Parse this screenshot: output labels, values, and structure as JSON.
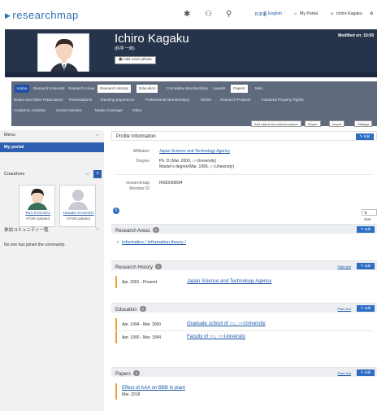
{
  "header": {
    "logo": "researchmap",
    "lang_jp": "日本語",
    "lang_sep": " | ",
    "lang_en": "English",
    "my_portal": "My Portal",
    "user": "Ichiro Kagaku"
  },
  "profile": {
    "name": "Ichiro Kagaku",
    "kana": "(科学 一郎)",
    "cover_button": "Add cover photo",
    "modified": "Modified on: 10:09"
  },
  "nav": {
    "tabs": [
      "Home",
      "Research Interests",
      "Research Areas",
      "Research History",
      "Education",
      "Committee Memberships",
      "Awards",
      "Papers",
      "Misc.",
      "Books and Other Publications",
      "Presentations",
      "Teaching Experience",
      "Professional Memberships",
      "Works",
      "Research Projects",
      "Industrial Property Rights",
      "Academic Activities",
      "Social Activities",
      "Media Coverage",
      "Other"
    ],
    "actions": [
      "Add data from external source",
      "Export",
      "Import",
      "Settings"
    ]
  },
  "sidebar": {
    "menu_title": "Menu",
    "my_portal": "My portal",
    "coauthors_title": "Coauthors",
    "coauthors": [
      {
        "name": "Taro KAGAKU",
        "date": "07/28 Updated"
      },
      {
        "name": "Hanako KAGAKU",
        "date": "07/28 Updated"
      }
    ],
    "community_title": "参加コミュニティ一覧",
    "community_empty": "No one has joined the community."
  },
  "profile_info": {
    "title": "Profile Information",
    "edit": "Edit",
    "affiliation_label": "Affiliation",
    "affiliation": "Japan Science and Technology Agency",
    "degree_label": "Degree",
    "degree_1": "Ph. D.(Mar. 2000, ○○University)",
    "degree_2": "Master's degree(Mar. 1996, ○○University)",
    "member_id_label_1": "researchmap",
    "member_id_label_2": "Member ID",
    "member_id": "R000036694",
    "sort": "Sort"
  },
  "research_areas": {
    "title": "Research Areas",
    "count": "1",
    "edit": "Edit",
    "item": "Informatics / Information theory /"
  },
  "research_history": {
    "title": "Research History",
    "count": "1",
    "plain": "Plain text",
    "edit": "Edit",
    "items": [
      {
        "date": "Apr. 2001 - Present",
        "title": "Japan Science and Technology Agency"
      }
    ]
  },
  "education": {
    "title": "Education",
    "count": "2",
    "plain": "Plain text",
    "edit": "Edit",
    "items": [
      {
        "date": "Apr. 1994 - Mar. 2000",
        "title": "Graduate school of ○○, ○○University"
      },
      {
        "date": "Apr. 1990 - Mar. 1994",
        "title": "Faculty of ○○, ○○University"
      }
    ]
  },
  "papers": {
    "title": "Papers",
    "count": "1",
    "plain": "Plain text",
    "edit": "Edit",
    "item_title": "Effect of AAA on BBB in plant",
    "item_date": "Mar. 2018"
  }
}
